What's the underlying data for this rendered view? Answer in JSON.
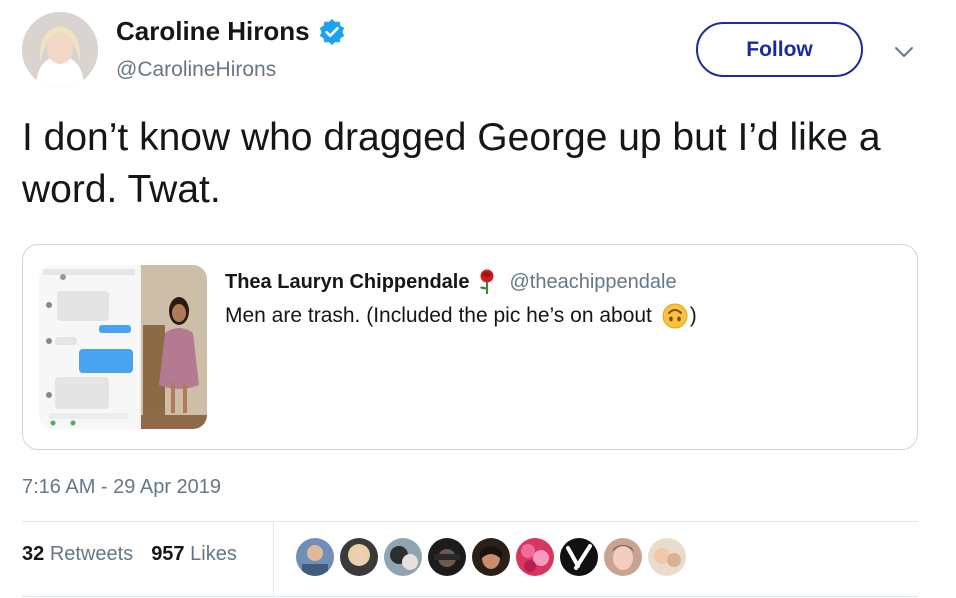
{
  "author": {
    "name": "Caroline Hirons",
    "handle": "@CarolineHirons",
    "verified": true,
    "avatar_icon": "user-avatar"
  },
  "follow_label": "Follow",
  "tweet_text": "I don’t know who dragged George up but I’d like a word. Twat.",
  "quoted": {
    "name": "Thea Lauryn Chippendale",
    "name_emoji": "rose-icon",
    "handle": "@theachippendale",
    "text_before": "Men are trash. (Included the pic he’s on about ",
    "text_emoji": "upside-down-face-icon",
    "text_after": ")"
  },
  "timestamp": "7:16 AM - 29 Apr 2019",
  "stats": {
    "retweets_count": "32",
    "retweets_label": "Retweets",
    "likes_count": "957",
    "likes_label": "Likes"
  },
  "liker_avatars": [
    "liker-1",
    "liker-2",
    "liker-3",
    "liker-4",
    "liker-5",
    "liker-6",
    "liker-7",
    "liker-8",
    "liker-9"
  ],
  "colors": {
    "follow_accent": "#1b2a9e",
    "verified": "#1da1f2",
    "muted_text": "#657786",
    "border": "#ccd6dd"
  }
}
